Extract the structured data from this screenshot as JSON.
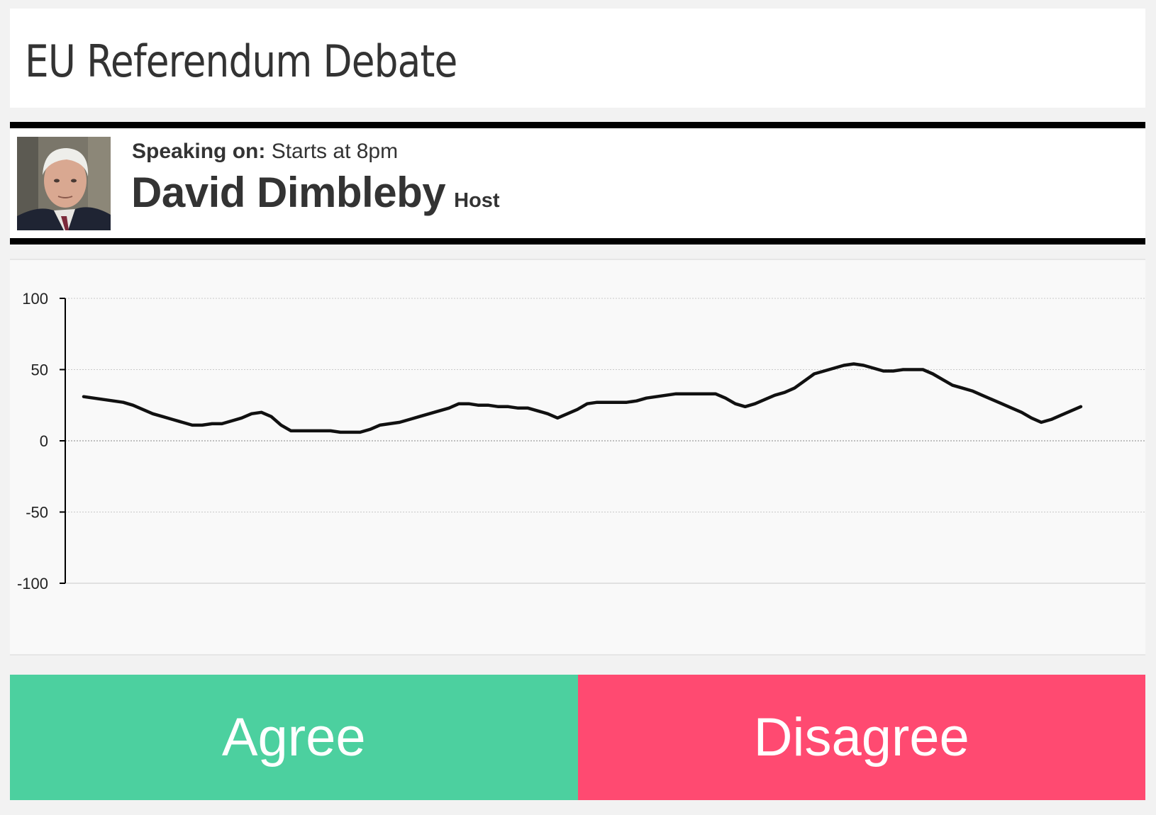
{
  "header": {
    "title": "EU Referendum Debate"
  },
  "speaker": {
    "speaking_label": "Speaking on:",
    "topic": "Starts at 8pm",
    "name": "David Dimbleby",
    "role": "Host"
  },
  "chart_data": {
    "type": "line",
    "title": "",
    "xlabel": "",
    "ylabel": "",
    "ylim": [
      -100,
      100
    ],
    "yticks": [
      "100",
      "50",
      "0",
      "-50",
      "-100"
    ],
    "grid": true,
    "series": [
      {
        "values": [
          31,
          30,
          29,
          28,
          27,
          25,
          22,
          19,
          17,
          15,
          13,
          11,
          11,
          12,
          12,
          14,
          16,
          19,
          20,
          17,
          11,
          7,
          7,
          7,
          7,
          7,
          6,
          6,
          6,
          8,
          11,
          12,
          13,
          15,
          17,
          19,
          21,
          23,
          26,
          26,
          25,
          25,
          24,
          24,
          23,
          23,
          21,
          19,
          16,
          19,
          22,
          26,
          27,
          27,
          27,
          27,
          28,
          30,
          31,
          32,
          33,
          33,
          33,
          33,
          33,
          30,
          26,
          24,
          26,
          29,
          32,
          34,
          37,
          42,
          47,
          49,
          51,
          53,
          54,
          53,
          51,
          49,
          49,
          50,
          50,
          50,
          47,
          43,
          39,
          37,
          35,
          32,
          29,
          26,
          23,
          20,
          16,
          13,
          15,
          18,
          21,
          24
        ]
      }
    ]
  },
  "votes": {
    "agree_label": "Agree",
    "disagree_label": "Disagree",
    "agree_color": "#4cd09f",
    "disagree_color": "#ff4a71"
  }
}
